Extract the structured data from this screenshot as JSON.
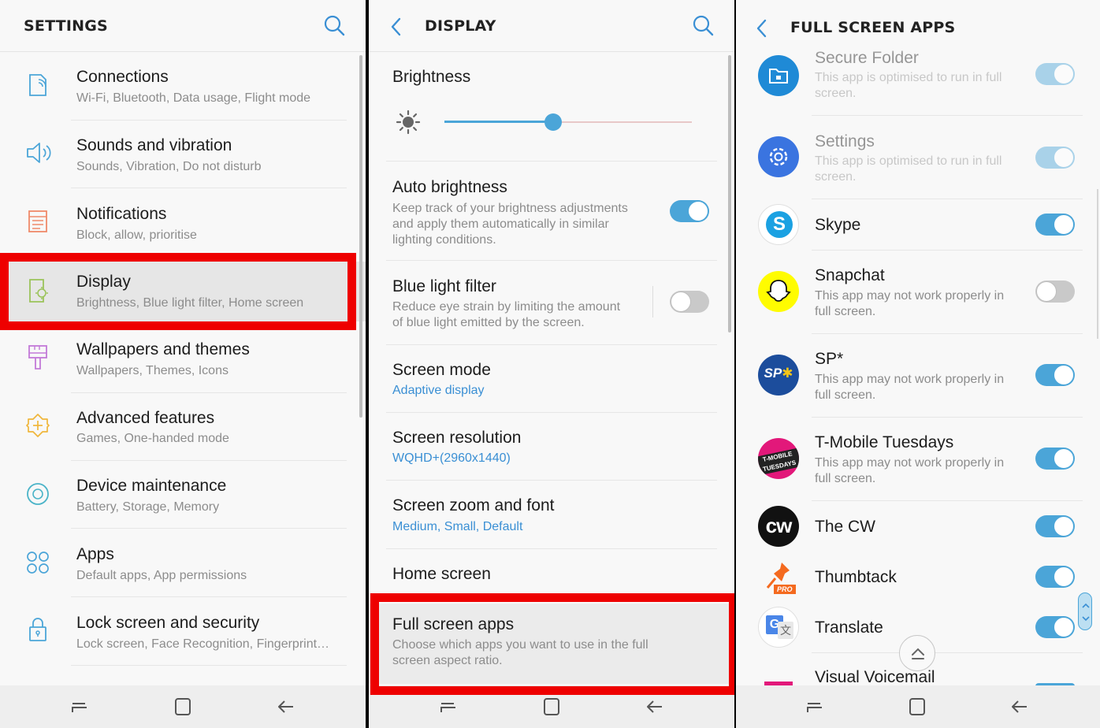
{
  "settings": {
    "title": "SETTINGS",
    "items": [
      {
        "title": "Connections",
        "subtitle": "Wi-Fi, Bluetooth, Data usage, Flight mode"
      },
      {
        "title": "Sounds and vibration",
        "subtitle": "Sounds, Vibration, Do not disturb"
      },
      {
        "title": "Notifications",
        "subtitle": "Block, allow, prioritise"
      },
      {
        "title": "Display",
        "subtitle": "Brightness, Blue light filter, Home screen"
      },
      {
        "title": "Wallpapers and themes",
        "subtitle": "Wallpapers, Themes, Icons"
      },
      {
        "title": "Advanced features",
        "subtitle": "Games, One-handed mode"
      },
      {
        "title": "Device maintenance",
        "subtitle": "Battery, Storage, Memory"
      },
      {
        "title": "Apps",
        "subtitle": "Default apps, App permissions"
      },
      {
        "title": "Lock screen and security",
        "subtitle": "Lock screen, Face Recognition, Fingerprint…"
      }
    ]
  },
  "display": {
    "title": "DISPLAY",
    "brightness": {
      "label": "Brightness",
      "level": 0.44
    },
    "auto_brightness": {
      "title": "Auto brightness",
      "line1": "Keep track of your brightness adjustments",
      "line2": "and apply them automatically in similar",
      "line3": "lighting conditions.",
      "enabled": true
    },
    "blue_light": {
      "title": "Blue light filter",
      "line1": "Reduce eye strain by limiting the amount",
      "line2": "of blue light emitted by the screen.",
      "enabled": false
    },
    "screen_mode": {
      "title": "Screen mode",
      "value": "Adaptive display"
    },
    "screen_resolution": {
      "title": "Screen resolution",
      "value": "WQHD+(2960x1440)"
    },
    "screen_zoom": {
      "title": "Screen zoom and font",
      "value": "Medium, Small, Default"
    },
    "home_screen": {
      "title": "Home screen"
    },
    "full_screen": {
      "title": "Full screen apps",
      "line1": "Choose which apps you want to use in the full",
      "line2": "screen aspect ratio."
    }
  },
  "full_screen_apps": {
    "title": "FULL SCREEN APPS",
    "optimised_line1": "This app is optimised to run in full",
    "optimised_line2": "screen.",
    "warning_line1": "This app may not work properly in",
    "warning_line2": "full screen.",
    "apps": [
      {
        "name": "Secure Folder",
        "enabled": true,
        "dimmed": true
      },
      {
        "name": "Settings",
        "enabled": true,
        "dimmed": true
      },
      {
        "name": "Skype",
        "enabled": true
      },
      {
        "name": "Snapchat",
        "enabled": false
      },
      {
        "name": "SP*",
        "enabled": true
      },
      {
        "name": "T-Mobile Tuesdays",
        "enabled": true
      },
      {
        "name": "The CW",
        "enabled": true
      },
      {
        "name": "Thumbtack",
        "enabled": true
      },
      {
        "name": "Translate",
        "enabled": true
      },
      {
        "name": "Visual Voicemail",
        "enabled": true
      }
    ],
    "icon_text": {
      "skype": "S",
      "sp": "SP",
      "tmobile": "T-MOBILE TUESDAYS",
      "cw": "cw",
      "thumbtack_pro": "PRO",
      "translate": "G"
    }
  },
  "colors": {
    "accent": "#4ba5d8",
    "highlight": "#ee0000",
    "link": "#3a8fd4"
  }
}
